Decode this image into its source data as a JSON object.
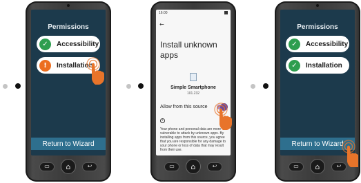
{
  "panel1": {
    "title": "Permissions",
    "items": [
      {
        "label": "Accessibility",
        "badge_icon": "check-icon",
        "badge_color": "#2e9e4f",
        "badge_glyph": "✓"
      },
      {
        "label": "Installation",
        "badge_icon": "exclamation-icon",
        "badge_color": "#ec6e1f",
        "badge_glyph": "!"
      }
    ],
    "return_button": "Return to Wizard"
  },
  "panel2": {
    "status_time": "16:00",
    "back_glyph": "←",
    "title": "Install unknown apps",
    "app_name": "Simple Smartphone",
    "app_version": "101.232",
    "allow_label": "Allow from this source",
    "allow_enabled": true,
    "info_glyph": "i",
    "warning": "Your phone and personal data are more vulnerable to attack by unknown apps. By installing apps from this source, you agree that you are responsible for any damage to your phone or loss of data that may result from their use."
  },
  "panel3": {
    "title": "Permissions",
    "items": [
      {
        "label": "Accessibility",
        "badge_icon": "check-icon",
        "badge_color": "#2e9e4f",
        "badge_glyph": "✓"
      },
      {
        "label": "Installation",
        "badge_icon": "check-icon",
        "badge_color": "#2e9e4f",
        "badge_glyph": "✓"
      }
    ],
    "return_button": "Return to Wizard"
  },
  "hardware_buttons": {
    "recent_glyph": "▭",
    "home_glyph": "⌂",
    "back_glyph": "↩"
  },
  "colors": {
    "screen_background": "#1c3a4c",
    "button_blue": "#2e6f8e",
    "success_green": "#2e9e4f",
    "warning_orange": "#ec6e1f",
    "toggle_purple": "#6c4a9a"
  }
}
